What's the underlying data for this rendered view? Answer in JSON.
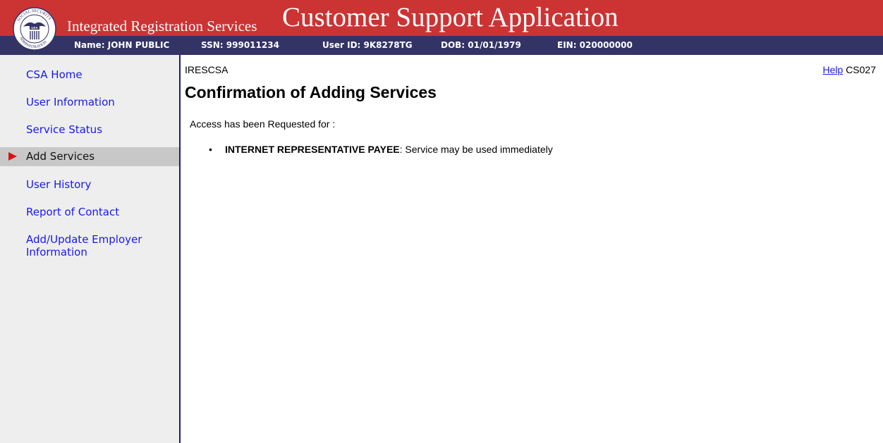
{
  "header": {
    "seal_lettering": "SOCIAL SECURITY USA ADMINISTRATION",
    "app_subtitle": "Integrated Registration Services",
    "app_title": "Customer Support Application",
    "colors": {
      "banner": "#cc3333",
      "infobar": "#333366"
    }
  },
  "info_bar": {
    "name": "Name: JOHN PUBLIC",
    "ssn": "SSN: 999011234",
    "user_id": "User ID: 9K8278TG",
    "dob": "DOB: 01/01/1979",
    "ein": "EIN: 020000000"
  },
  "sidebar": {
    "items": [
      {
        "label": "CSA Home"
      },
      {
        "label": "User Information"
      },
      {
        "label": "Service Status"
      },
      {
        "label": "Add Services",
        "active": true,
        "icon": "red-arrow-icon"
      },
      {
        "label": "User History"
      },
      {
        "label": "Report of Contact"
      },
      {
        "label": "Add/Update Employer Information"
      }
    ]
  },
  "main": {
    "app_id": "IRESCSA",
    "help_label": "Help",
    "screen_code": "CS027",
    "title": "Confirmation of Adding Services",
    "intro": "Access has been Requested for :",
    "services": [
      {
        "name": "INTERNET REPRESENTATIVE PAYEE",
        "status": ": Service may be used immediately"
      }
    ]
  }
}
